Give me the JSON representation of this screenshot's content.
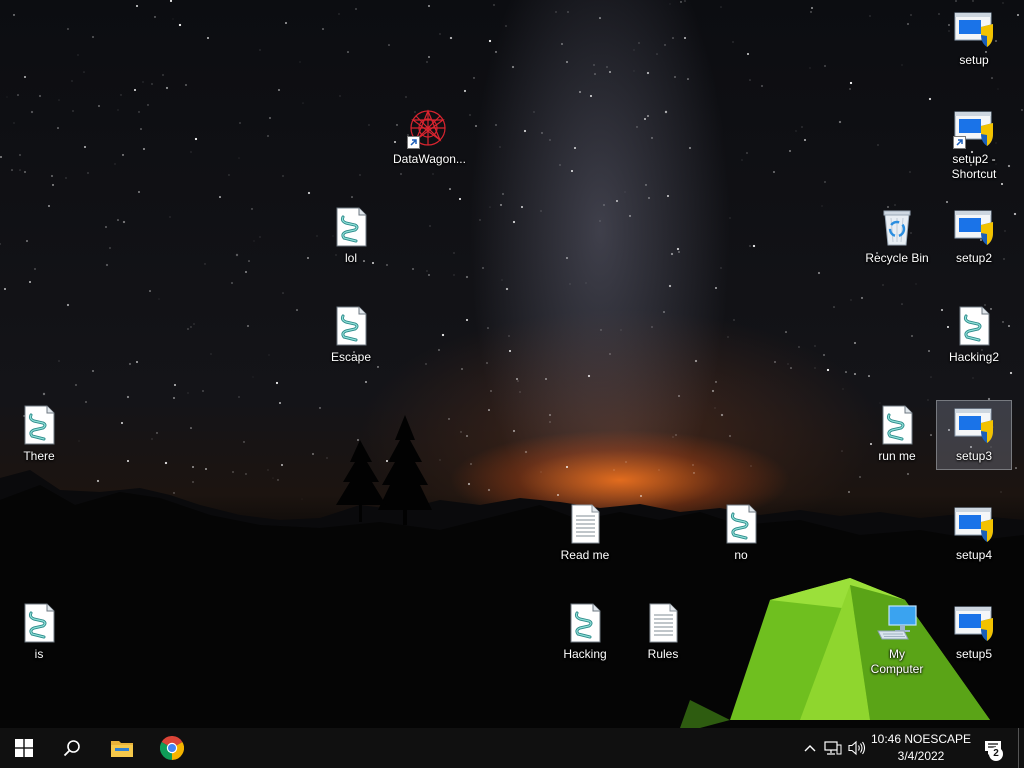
{
  "desktop": {
    "icons": [
      {
        "id": "datawagon",
        "label": "DataWagon...",
        "type": "app",
        "shortcut": true
      },
      {
        "id": "lol",
        "label": "lol",
        "type": "script"
      },
      {
        "id": "escape",
        "label": "Escape",
        "type": "script"
      },
      {
        "id": "there",
        "label": "There",
        "type": "script"
      },
      {
        "id": "is",
        "label": "is",
        "type": "script"
      },
      {
        "id": "read-me",
        "label": "Read me",
        "type": "text"
      },
      {
        "id": "no",
        "label": "no",
        "type": "script"
      },
      {
        "id": "hacking",
        "label": "Hacking",
        "type": "script"
      },
      {
        "id": "rules",
        "label": "Rules",
        "type": "text"
      },
      {
        "id": "setup",
        "label": "setup",
        "type": "installer"
      },
      {
        "id": "setup2-shortcut",
        "label": "setup2 - Shortcut",
        "type": "installer",
        "shortcut": true
      },
      {
        "id": "recycle-bin",
        "label": "Recycle Bin",
        "type": "recycle-bin"
      },
      {
        "id": "setup2",
        "label": "setup2",
        "type": "installer"
      },
      {
        "id": "hacking2",
        "label": "Hacking2",
        "type": "script"
      },
      {
        "id": "run-me",
        "label": "run me",
        "type": "script"
      },
      {
        "id": "setup3",
        "label": "setup3",
        "type": "installer",
        "selected": true
      },
      {
        "id": "setup4",
        "label": "setup4",
        "type": "installer"
      },
      {
        "id": "my-computer",
        "label": "My Computer",
        "type": "computer"
      },
      {
        "id": "setup5",
        "label": "setup5",
        "type": "installer"
      }
    ]
  },
  "taskbar": {
    "start_icon": "windows-logo-icon",
    "search_icon": "search-icon",
    "pinned": [
      {
        "id": "file-explorer",
        "icon": "folder-icon"
      },
      {
        "id": "chrome",
        "icon": "chrome-icon"
      }
    ],
    "tray": {
      "overflow_icon": "chevron-up-icon",
      "network_icon": "network-icon",
      "volume_icon": "speaker-icon"
    },
    "clock": {
      "time": "10:46 NOESCAPE",
      "date": "3/4/2022"
    },
    "notifications": {
      "icon": "notification-icon",
      "count": "2"
    }
  },
  "colors": {
    "taskbar_bg": "#101010",
    "selection": "#9aa4b8",
    "tent_green": "#7ed321",
    "horizon_orange": "#ff7a1e"
  }
}
